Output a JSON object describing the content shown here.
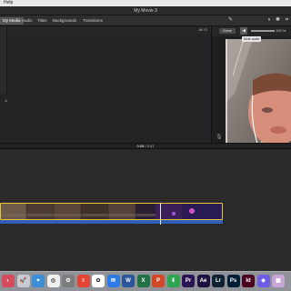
{
  "menubar": {
    "help_label": "Help"
  },
  "window": {
    "title": "My Movie 3"
  },
  "tabs": [
    {
      "label": "My Media",
      "active": true
    },
    {
      "label": "Audio",
      "active": false
    },
    {
      "label": "Titles",
      "active": false
    },
    {
      "label": "Backgrounds",
      "active": false
    },
    {
      "label": "Transitions",
      "active": false
    }
  ],
  "browser": {
    "filter_label": "All Cl"
  },
  "viewer": {
    "toolbar": {
      "button_label": "Done",
      "tooltip": "Mute audio",
      "volume_value": "100 %"
    },
    "icons": [
      "magic-wand-icon",
      "color-balance-icon",
      "color-palette-icon",
      "crop-icon"
    ]
  },
  "timecode": {
    "current": "0:08",
    "total": "0:47"
  },
  "timeline": {
    "clip_colors": {
      "border": "#e8c23a",
      "audio": "#2f5fb8"
    }
  },
  "dock": {
    "apps": [
      {
        "name": "Finder",
        "color": "#d64b5c",
        "glyph": "◐"
      },
      {
        "name": "Launchpad",
        "color": "#c7ccd2",
        "glyph": "🚀"
      },
      {
        "name": "Safari",
        "color": "#3b8fd9",
        "glyph": "⌖"
      },
      {
        "name": "Chrome",
        "color": "#f0f0f0",
        "glyph": "◎"
      },
      {
        "name": "System Preferences",
        "color": "#7d7d7d",
        "glyph": "⚙"
      },
      {
        "name": "Todoist",
        "color": "#e44232",
        "glyph": "≡"
      },
      {
        "name": "Photos",
        "color": "#ffffff",
        "glyph": "✿"
      },
      {
        "name": "Messages",
        "color": "#2f7be6",
        "glyph": "✉"
      },
      {
        "name": "Word",
        "color": "#2b579a",
        "glyph": "W"
      },
      {
        "name": "Excel",
        "color": "#217346",
        "glyph": "X"
      },
      {
        "name": "PowerPoint",
        "color": "#d24726",
        "glyph": "P"
      },
      {
        "name": "Green App",
        "color": "#2ea44f",
        "glyph": "⬇"
      },
      {
        "name": "Premiere Pro",
        "color": "#2a1454",
        "glyph": "Pr"
      },
      {
        "name": "After Effects",
        "color": "#1f1040",
        "glyph": "Ae"
      },
      {
        "name": "Lightroom",
        "color": "#0f2233",
        "glyph": "Lr"
      },
      {
        "name": "Photoshop",
        "color": "#001e36",
        "glyph": "Ps"
      },
      {
        "name": "InDesign",
        "color": "#49021f",
        "glyph": "Id"
      },
      {
        "name": "Purple App",
        "color": "#6c5ce7",
        "glyph": "◆"
      },
      {
        "name": "Preview",
        "color": "#c9a4d8",
        "glyph": "▦"
      }
    ]
  }
}
